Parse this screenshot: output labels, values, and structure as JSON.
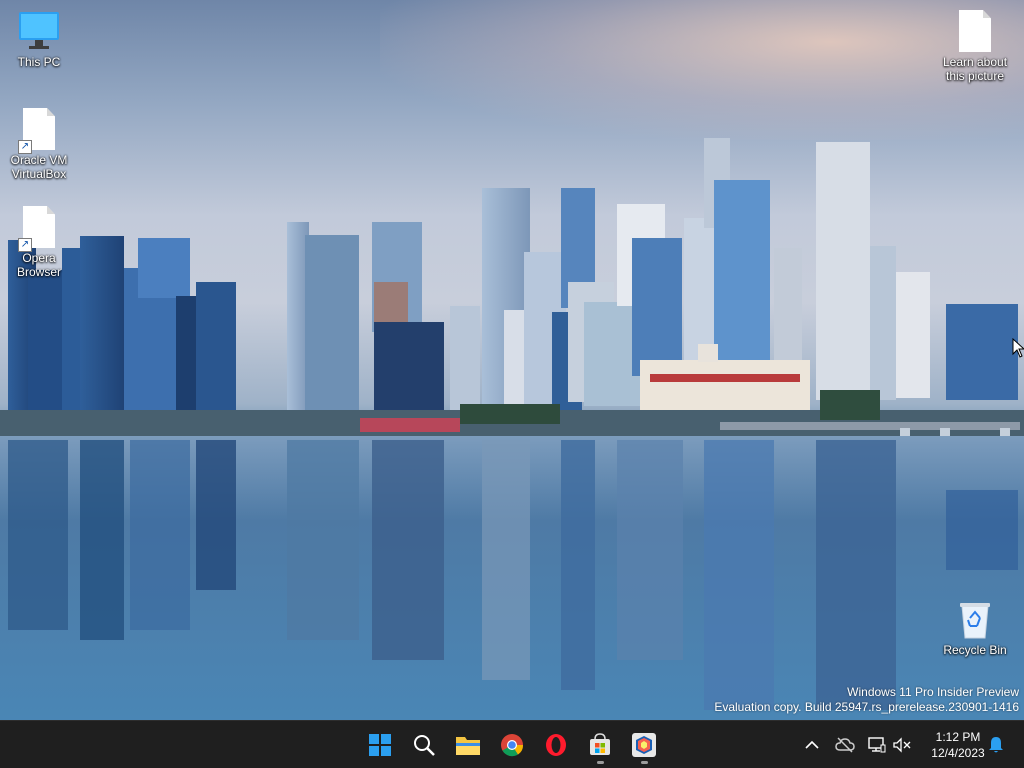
{
  "desktop": {
    "icons": [
      {
        "label": "This PC"
      },
      {
        "label": "Oracle VM VirtualBox"
      },
      {
        "label": "Opera Browser"
      },
      {
        "label": "Learn about this picture"
      },
      {
        "label": "Recycle Bin"
      }
    ],
    "watermark": {
      "line1": "Windows 11 Pro Insider Preview",
      "line2": "Evaluation copy. Build 25947.rs_prerelease.230901-1416"
    }
  },
  "taskbar": {
    "pinned": [
      {
        "name": "Start",
        "icon": "windows-logo-icon"
      },
      {
        "name": "Search",
        "icon": "search-icon"
      },
      {
        "name": "File Explorer",
        "icon": "folder-icon"
      },
      {
        "name": "Google Chrome",
        "icon": "chrome-icon"
      },
      {
        "name": "Opera",
        "icon": "opera-icon"
      },
      {
        "name": "Microsoft Store",
        "icon": "store-icon",
        "running": true
      },
      {
        "name": "Oracle VM VirtualBox",
        "icon": "virtualbox-icon",
        "running": true
      }
    ],
    "tray": {
      "icons": [
        "chevron-up-icon",
        "cloud-offline-icon",
        "network-icon",
        "volume-muted-icon",
        "notification-bell-icon"
      ]
    },
    "clock": {
      "time": "1:12 PM",
      "date": "12/4/2023"
    }
  },
  "colors": {
    "taskbar_bg": "#1f1f1f",
    "accent": "#2b9ff0"
  }
}
